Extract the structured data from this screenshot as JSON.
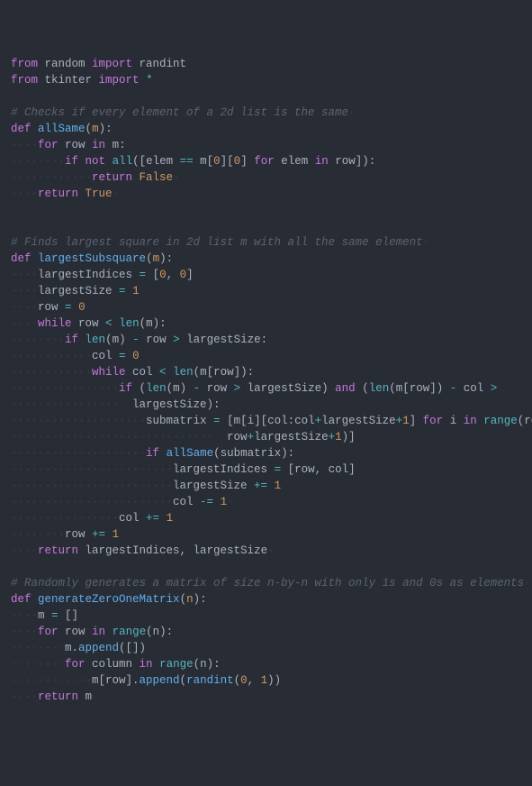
{
  "lines": [
    {
      "segments": [
        {
          "cls": "kw",
          "t": "from"
        },
        {
          "cls": "",
          "t": " random "
        },
        {
          "cls": "kw",
          "t": "import"
        },
        {
          "cls": "",
          "t": " randint"
        }
      ]
    },
    {
      "segments": [
        {
          "cls": "kw",
          "t": "from"
        },
        {
          "cls": "",
          "t": " tkinter "
        },
        {
          "cls": "kw",
          "t": "import"
        },
        {
          "cls": "",
          "t": " "
        },
        {
          "cls": "op",
          "t": "*"
        }
      ]
    },
    {
      "segments": []
    },
    {
      "segments": [
        {
          "cls": "cmt",
          "t": "# Checks if every element of a 2d list is the same"
        },
        {
          "cls": "ws",
          "t": "·"
        }
      ]
    },
    {
      "segments": [
        {
          "cls": "def",
          "t": "def"
        },
        {
          "cls": "",
          "t": " "
        },
        {
          "cls": "name",
          "t": "allSame"
        },
        {
          "cls": "",
          "t": "("
        },
        {
          "cls": "param",
          "t": "m"
        },
        {
          "cls": "",
          "t": "):"
        }
      ]
    },
    {
      "segments": [
        {
          "cls": "ws",
          "t": "····"
        },
        {
          "cls": "kw",
          "t": "for"
        },
        {
          "cls": "",
          "t": " row "
        },
        {
          "cls": "kw",
          "t": "in"
        },
        {
          "cls": "",
          "t": " m:"
        }
      ]
    },
    {
      "segments": [
        {
          "cls": "ws",
          "t": "········"
        },
        {
          "cls": "kw",
          "t": "if"
        },
        {
          "cls": "",
          "t": " "
        },
        {
          "cls": "kw",
          "t": "not"
        },
        {
          "cls": "",
          "t": " "
        },
        {
          "cls": "builtin",
          "t": "all"
        },
        {
          "cls": "",
          "t": "([elem "
        },
        {
          "cls": "op",
          "t": "=="
        },
        {
          "cls": "",
          "t": " m["
        },
        {
          "cls": "num",
          "t": "0"
        },
        {
          "cls": "",
          "t": "]["
        },
        {
          "cls": "num",
          "t": "0"
        },
        {
          "cls": "",
          "t": "] "
        },
        {
          "cls": "kw",
          "t": "for"
        },
        {
          "cls": "",
          "t": " elem "
        },
        {
          "cls": "kw",
          "t": "in"
        },
        {
          "cls": "",
          "t": " row]):"
        }
      ]
    },
    {
      "segments": [
        {
          "cls": "ws",
          "t": "············"
        },
        {
          "cls": "kw",
          "t": "return"
        },
        {
          "cls": "",
          "t": " "
        },
        {
          "cls": "const",
          "t": "False"
        },
        {
          "cls": "ws",
          "t": "·"
        }
      ]
    },
    {
      "segments": [
        {
          "cls": "ws",
          "t": "····"
        },
        {
          "cls": "kw",
          "t": "return"
        },
        {
          "cls": "",
          "t": " "
        },
        {
          "cls": "const",
          "t": "True"
        },
        {
          "cls": "ws",
          "t": "·"
        }
      ]
    },
    {
      "segments": []
    },
    {
      "segments": []
    },
    {
      "segments": [
        {
          "cls": "cmt",
          "t": "# Finds largest square in 2d list m with all the same element"
        },
        {
          "cls": "ws",
          "t": "·"
        }
      ]
    },
    {
      "segments": [
        {
          "cls": "def",
          "t": "def"
        },
        {
          "cls": "",
          "t": " "
        },
        {
          "cls": "name",
          "t": "largestSubsquare"
        },
        {
          "cls": "",
          "t": "("
        },
        {
          "cls": "param",
          "t": "m"
        },
        {
          "cls": "",
          "t": "):"
        }
      ]
    },
    {
      "segments": [
        {
          "cls": "ws",
          "t": "····"
        },
        {
          "cls": "",
          "t": "largestIndices "
        },
        {
          "cls": "op",
          "t": "="
        },
        {
          "cls": "",
          "t": " ["
        },
        {
          "cls": "num",
          "t": "0"
        },
        {
          "cls": "",
          "t": ", "
        },
        {
          "cls": "num",
          "t": "0"
        },
        {
          "cls": "",
          "t": "]"
        }
      ]
    },
    {
      "segments": [
        {
          "cls": "ws",
          "t": "····"
        },
        {
          "cls": "",
          "t": "largestSize "
        },
        {
          "cls": "op",
          "t": "="
        },
        {
          "cls": "",
          "t": " "
        },
        {
          "cls": "num",
          "t": "1"
        }
      ]
    },
    {
      "segments": [
        {
          "cls": "ws",
          "t": "····"
        },
        {
          "cls": "",
          "t": "row "
        },
        {
          "cls": "op",
          "t": "="
        },
        {
          "cls": "",
          "t": " "
        },
        {
          "cls": "num",
          "t": "0"
        }
      ]
    },
    {
      "segments": [
        {
          "cls": "ws",
          "t": "····"
        },
        {
          "cls": "kw",
          "t": "while"
        },
        {
          "cls": "",
          "t": " row "
        },
        {
          "cls": "op",
          "t": "<"
        },
        {
          "cls": "",
          "t": " "
        },
        {
          "cls": "builtin",
          "t": "len"
        },
        {
          "cls": "",
          "t": "(m):"
        }
      ]
    },
    {
      "segments": [
        {
          "cls": "ws",
          "t": "········"
        },
        {
          "cls": "kw",
          "t": "if"
        },
        {
          "cls": "",
          "t": " "
        },
        {
          "cls": "builtin",
          "t": "len"
        },
        {
          "cls": "",
          "t": "(m) "
        },
        {
          "cls": "op",
          "t": "-"
        },
        {
          "cls": "",
          "t": " row "
        },
        {
          "cls": "op",
          "t": ">"
        },
        {
          "cls": "",
          "t": " largestSize:"
        }
      ]
    },
    {
      "segments": [
        {
          "cls": "ws",
          "t": "············"
        },
        {
          "cls": "",
          "t": "col "
        },
        {
          "cls": "op",
          "t": "="
        },
        {
          "cls": "",
          "t": " "
        },
        {
          "cls": "num",
          "t": "0"
        }
      ]
    },
    {
      "segments": [
        {
          "cls": "ws",
          "t": "············"
        },
        {
          "cls": "kw",
          "t": "while"
        },
        {
          "cls": "",
          "t": " col "
        },
        {
          "cls": "op",
          "t": "<"
        },
        {
          "cls": "",
          "t": " "
        },
        {
          "cls": "builtin",
          "t": "len"
        },
        {
          "cls": "",
          "t": "(m[row]):"
        }
      ]
    },
    {
      "segments": [
        {
          "cls": "ws",
          "t": "················"
        },
        {
          "cls": "kw",
          "t": "if"
        },
        {
          "cls": "",
          "t": " ("
        },
        {
          "cls": "builtin",
          "t": "len"
        },
        {
          "cls": "",
          "t": "(m) "
        },
        {
          "cls": "op",
          "t": "-"
        },
        {
          "cls": "",
          "t": " row "
        },
        {
          "cls": "op",
          "t": ">"
        },
        {
          "cls": "",
          "t": " largestSize) "
        },
        {
          "cls": "kw",
          "t": "and"
        },
        {
          "cls": "",
          "t": " ("
        },
        {
          "cls": "builtin",
          "t": "len"
        },
        {
          "cls": "",
          "t": "(m[row]) "
        },
        {
          "cls": "op",
          "t": "-"
        },
        {
          "cls": "",
          "t": " col "
        },
        {
          "cls": "op",
          "t": ">"
        },
        {
          "cls": "",
          "t": " "
        }
      ]
    },
    {
      "segments": [
        {
          "cls": "ws",
          "t": "················  "
        },
        {
          "cls": "",
          "t": "largestSize):"
        }
      ]
    },
    {
      "segments": [
        {
          "cls": "ws",
          "t": "····················"
        },
        {
          "cls": "",
          "t": "submatrix "
        },
        {
          "cls": "op",
          "t": "="
        },
        {
          "cls": "",
          "t": " [m[i][col:col"
        },
        {
          "cls": "op",
          "t": "+"
        },
        {
          "cls": "",
          "t": "largestSize"
        },
        {
          "cls": "op",
          "t": "+"
        },
        {
          "cls": "num",
          "t": "1"
        },
        {
          "cls": "",
          "t": "] "
        },
        {
          "cls": "kw",
          "t": "for"
        },
        {
          "cls": "",
          "t": " i "
        },
        {
          "cls": "kw",
          "t": "in"
        },
        {
          "cls": "",
          "t": " "
        },
        {
          "cls": "builtin",
          "t": "range"
        },
        {
          "cls": "",
          "t": "(row,"
        }
      ]
    },
    {
      "segments": [
        {
          "cls": "ws",
          "t": "······························  "
        },
        {
          "cls": "",
          "t": "row"
        },
        {
          "cls": "op",
          "t": "+"
        },
        {
          "cls": "",
          "t": "largestSize"
        },
        {
          "cls": "op",
          "t": "+"
        },
        {
          "cls": "num",
          "t": "1"
        },
        {
          "cls": "",
          "t": ")]"
        }
      ]
    },
    {
      "segments": [
        {
          "cls": "ws",
          "t": "····················"
        },
        {
          "cls": "kw",
          "t": "if"
        },
        {
          "cls": "",
          "t": " "
        },
        {
          "cls": "fn",
          "t": "allSame"
        },
        {
          "cls": "",
          "t": "(submatrix):"
        }
      ]
    },
    {
      "segments": [
        {
          "cls": "ws",
          "t": "························"
        },
        {
          "cls": "",
          "t": "largestIndices "
        },
        {
          "cls": "op",
          "t": "="
        },
        {
          "cls": "",
          "t": " [row, col]"
        }
      ]
    },
    {
      "segments": [
        {
          "cls": "ws",
          "t": "························"
        },
        {
          "cls": "",
          "t": "largestSize "
        },
        {
          "cls": "op",
          "t": "+="
        },
        {
          "cls": "",
          "t": " "
        },
        {
          "cls": "num",
          "t": "1"
        }
      ]
    },
    {
      "segments": [
        {
          "cls": "ws",
          "t": "························"
        },
        {
          "cls": "",
          "t": "col "
        },
        {
          "cls": "op",
          "t": "-="
        },
        {
          "cls": "",
          "t": " "
        },
        {
          "cls": "num",
          "t": "1"
        },
        {
          "cls": "ws",
          "t": "·"
        }
      ]
    },
    {
      "segments": [
        {
          "cls": "ws",
          "t": "················"
        },
        {
          "cls": "",
          "t": "col "
        },
        {
          "cls": "op",
          "t": "+="
        },
        {
          "cls": "",
          "t": " "
        },
        {
          "cls": "num",
          "t": "1"
        }
      ]
    },
    {
      "segments": [
        {
          "cls": "ws",
          "t": "········"
        },
        {
          "cls": "",
          "t": "row "
        },
        {
          "cls": "op",
          "t": "+="
        },
        {
          "cls": "",
          "t": " "
        },
        {
          "cls": "num",
          "t": "1"
        }
      ]
    },
    {
      "segments": [
        {
          "cls": "ws",
          "t": "····"
        },
        {
          "cls": "kw",
          "t": "return"
        },
        {
          "cls": "",
          "t": " largestIndices, largestSize"
        },
        {
          "cls": "ws",
          "t": "·"
        }
      ]
    },
    {
      "segments": []
    },
    {
      "segments": [
        {
          "cls": "cmt",
          "t": "# Randomly generates a matrix of size n-by-n with only 1s and 0s as elements"
        },
        {
          "cls": "ws",
          "t": "·"
        }
      ]
    },
    {
      "segments": [
        {
          "cls": "def",
          "t": "def"
        },
        {
          "cls": "",
          "t": " "
        },
        {
          "cls": "name",
          "t": "generateZeroOneMatrix"
        },
        {
          "cls": "",
          "t": "("
        },
        {
          "cls": "param",
          "t": "n"
        },
        {
          "cls": "",
          "t": "):"
        }
      ]
    },
    {
      "segments": [
        {
          "cls": "ws",
          "t": "····"
        },
        {
          "cls": "",
          "t": "m "
        },
        {
          "cls": "op",
          "t": "="
        },
        {
          "cls": "",
          "t": " []"
        }
      ]
    },
    {
      "segments": [
        {
          "cls": "ws",
          "t": "····"
        },
        {
          "cls": "kw",
          "t": "for"
        },
        {
          "cls": "",
          "t": " row "
        },
        {
          "cls": "kw",
          "t": "in"
        },
        {
          "cls": "",
          "t": " "
        },
        {
          "cls": "builtin",
          "t": "range"
        },
        {
          "cls": "",
          "t": "(n):"
        }
      ]
    },
    {
      "segments": [
        {
          "cls": "ws",
          "t": "········"
        },
        {
          "cls": "",
          "t": "m."
        },
        {
          "cls": "fn",
          "t": "append"
        },
        {
          "cls": "",
          "t": "([])"
        }
      ]
    },
    {
      "segments": [
        {
          "cls": "ws",
          "t": "········"
        },
        {
          "cls": "kw",
          "t": "for"
        },
        {
          "cls": "",
          "t": " column "
        },
        {
          "cls": "kw",
          "t": "in"
        },
        {
          "cls": "",
          "t": " "
        },
        {
          "cls": "builtin",
          "t": "range"
        },
        {
          "cls": "",
          "t": "(n):"
        }
      ]
    },
    {
      "segments": [
        {
          "cls": "ws",
          "t": "············"
        },
        {
          "cls": "",
          "t": "m[row]."
        },
        {
          "cls": "fn",
          "t": "append"
        },
        {
          "cls": "",
          "t": "("
        },
        {
          "cls": "fn",
          "t": "randint"
        },
        {
          "cls": "",
          "t": "("
        },
        {
          "cls": "num",
          "t": "0"
        },
        {
          "cls": "",
          "t": ", "
        },
        {
          "cls": "num",
          "t": "1"
        },
        {
          "cls": "",
          "t": "))"
        }
      ]
    },
    {
      "segments": [
        {
          "cls": "ws",
          "t": "····"
        },
        {
          "cls": "kw",
          "t": "return"
        },
        {
          "cls": "",
          "t": " m"
        }
      ]
    }
  ]
}
